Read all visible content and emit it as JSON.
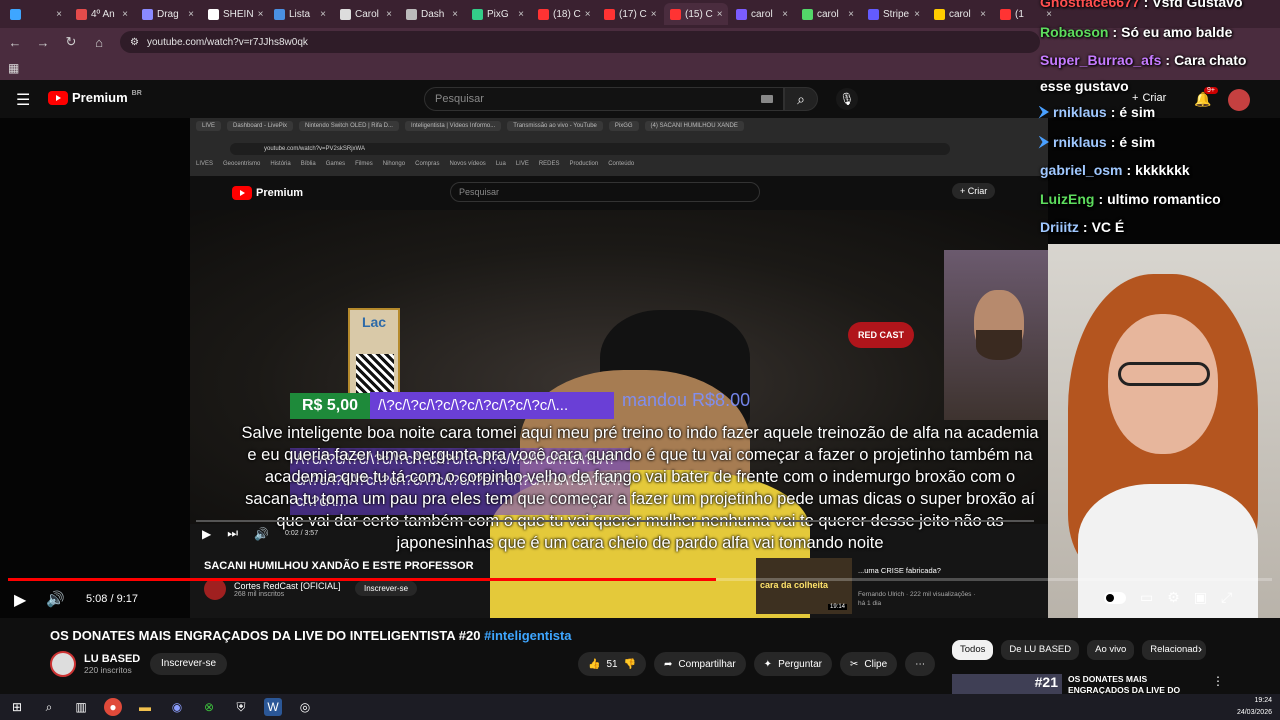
{
  "browser": {
    "tabs": [
      {
        "label": "",
        "color": "#3ea6ff"
      },
      {
        "label": "4º An",
        "color": "#e34b4b"
      },
      {
        "label": "Drag",
        "color": "#8a8aff"
      },
      {
        "label": "SHEIN",
        "color": "#ffffff"
      },
      {
        "label": "Lista",
        "color": "#4a90e2"
      },
      {
        "label": "Carol",
        "color": "#dddddd"
      },
      {
        "label": "Dash",
        "color": "#bbbbbb"
      },
      {
        "label": "PixG",
        "color": "#33cc88"
      },
      {
        "label": "(18) C",
        "color": "#ff3333"
      },
      {
        "label": "(17) C",
        "color": "#ff3333"
      },
      {
        "label": "(15) C",
        "color": "#ff3333"
      },
      {
        "label": "carol",
        "color": "#7b5cff"
      },
      {
        "label": "carol",
        "color": "#53d769"
      },
      {
        "label": "Stripe",
        "color": "#635bff"
      },
      {
        "label": "carol",
        "color": "#ffcc00"
      },
      {
        "label": "(1",
        "color": "#ff3333"
      }
    ],
    "url": "youtube.com/watch?v=r7JJhs8w0qk"
  },
  "youtube": {
    "logo": "Premium",
    "region": "BR",
    "search_placeholder": "Pesquisar",
    "create_label": "Criar",
    "notif_count": "9+"
  },
  "inner": {
    "tabs": [
      "LIVE",
      "Dashboard - LivePix",
      "Nintendo Switch OLED | Rifa D...",
      "Inteligentista | Vídeos Informo...",
      "Transmissão ao vivo - YouTube",
      "PixGG",
      "(4) SACANI HUMILHOU XANDE"
    ],
    "url": "youtube.com/watch?v=PV2skSRjxWA",
    "bookmarks": [
      "LIVES",
      "Geocentrismo",
      "História",
      "Bíblia",
      "Games",
      "Filmes",
      "Nihongo",
      "Compras",
      "Novos vídeos",
      "Lua",
      "LIVE",
      "REDES",
      "Production",
      "Conteúdo"
    ],
    "logo": "Premium",
    "search": "Pesquisar",
    "create": "Criar",
    "lac": "Lac",
    "redcast": "RED CAST",
    "time": "0:02 / 3:57",
    "title": "SACANI HUMILHOU XANDÃO E ESTE PROFESSOR",
    "channel": "Cortes RedCast [OFICIAL]",
    "subs": "268 mil inscritos",
    "subscribe": "Inscrever-se",
    "side_thumb_label": "cara da colheita",
    "side_duration": "19:14",
    "side_title": "...uma CRISE fabricada?",
    "side_meta": "Fernando Ulrich · 222 mil visualizações · há 1 dia"
  },
  "donation": {
    "amount": "R$ 5,00",
    "donor": "/\\?c/\\?c/\\?c/\\?c/\\?c/\\?c/\\?c/\\...",
    "faint": "mandou R$8.00",
    "message": "Salve inteligente boa noite cara tomei aqui meu pré treino to indo fazer aquele treinozão de alfa na academia e eu queria fazer uma pergunta pra você cara quando é que tu vai começar a fazer o projetinho também na academia que tu tá com o corpinho velho de frango vai bater de frente com o indemurgo broxão com o sacana tu toma um pau pra eles tem que começar a fazer um projetinho pede umas dicas o super broxão aí que vai dar certo também com o que tu vai querer mulher nenhuma vai te querer desse jeito não as japonesinhas que é um cara cheio de pardo alfa vai tomando noite",
    "message2": "/\\?c/\\?c/\\?c/\\?c/\\?c/\\?c/\\?c/\\?c/\\?c/\\?c/\\?c/\\?c/\\?c/\\?c/\\?c/\\?c/\\?c/\\?c/\\?c/\\?c/\\?c/\\?c/\\?c/\\?c/\\?c/\\?c/\\?c/\\?c/\\?c/\\..."
  },
  "player": {
    "time": "5:08 / 9:17",
    "progress": 0.56
  },
  "chat": [
    {
      "user": "Ghostface6677",
      "msg": "Vsfd Gustavo",
      "color": "#ff4f4f",
      "badge": false
    },
    {
      "user": "Robaoson",
      "msg": "Só eu amo balde",
      "color": "#5ddc5d",
      "badge": false
    },
    {
      "user": "Super_Burrao_afs",
      "msg": "Cara chato",
      "color": "#c67bff",
      "badge": false
    },
    {
      "user": "",
      "msg": "esse gustavo",
      "color": "#ffffff",
      "badge": false
    },
    {
      "user": "rniklaus",
      "msg": "é sim",
      "color": "#a0c8ff",
      "badge": true
    },
    {
      "user": "rniklaus",
      "msg": "é sim",
      "color": "#a0c8ff",
      "badge": true
    },
    {
      "user": "gabriel_osm",
      "msg": "kkkkkkk",
      "color": "#a0c8ff",
      "badge": false
    },
    {
      "user": "LuizEng",
      "msg": "ultimo romantico",
      "color": "#5ddc5d",
      "badge": false
    },
    {
      "user": "Driiitz",
      "msg": "VC É",
      "color": "#a0c8ff",
      "badge": false
    }
  ],
  "video": {
    "title": "OS DONATES MAIS ENGRAÇADOS DA LIVE DO INTELIGENTISTA #20",
    "hashtag": "#inteligentista",
    "channel": "LU BASED",
    "subs": "220 inscritos",
    "subscribe": "Inscrever-se",
    "likes": "51",
    "share": "Compartilhar",
    "ask": "Perguntar",
    "clip": "Clipe"
  },
  "sidebar": {
    "chips": [
      "Todos",
      "De LU BASED",
      "Ao vivo",
      "Relacionad"
    ],
    "rec_number": "#21",
    "rec_title": "OS DONATES MAIS ENGRAÇADOS DA LIVE DO"
  },
  "taskbar": {
    "time": "19:24",
    "date": "24/03/2026"
  }
}
